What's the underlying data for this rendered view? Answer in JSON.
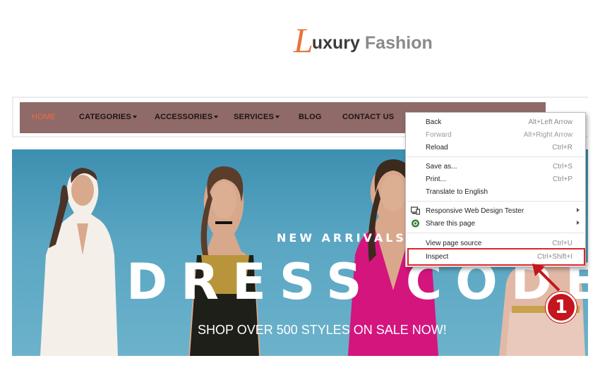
{
  "logo": {
    "initial": "L",
    "word1": "uxury",
    "word2": "Fashion"
  },
  "nav": {
    "items": [
      {
        "label": "HOME",
        "active": true,
        "has_dropdown": false
      },
      {
        "label": "CATEGORIES",
        "active": false,
        "has_dropdown": true
      },
      {
        "label": "ACCESSORIES",
        "active": false,
        "has_dropdown": true
      },
      {
        "label": "SERVICES",
        "active": false,
        "has_dropdown": true
      },
      {
        "label": "BLOG",
        "active": false,
        "has_dropdown": false
      },
      {
        "label": "CONTACT US",
        "active": false,
        "has_dropdown": false
      }
    ]
  },
  "hero": {
    "subtitle": "NEW ARRIVALS",
    "title": "DRESS CODE",
    "tagline": "SHOP OVER 500 STYLES ON SALE NOW!"
  },
  "context_menu": {
    "items": [
      {
        "label": "Back",
        "shortcut": "Alt+Left Arrow",
        "disabled": false
      },
      {
        "label": "Forward",
        "shortcut": "Alt+Right Arrow",
        "disabled": true
      },
      {
        "label": "Reload",
        "shortcut": "Ctrl+R",
        "disabled": false
      },
      {
        "label": "Save as...",
        "shortcut": "Ctrl+S",
        "disabled": false
      },
      {
        "label": "Print...",
        "shortcut": "Ctrl+P",
        "disabled": false
      },
      {
        "label": "Translate to English",
        "shortcut": "",
        "disabled": false
      },
      {
        "label": "Responsive Web Design Tester",
        "shortcut": "",
        "icon": "responsive-tester-icon",
        "submenu": true
      },
      {
        "label": "Share this page",
        "shortcut": "",
        "icon": "share-icon",
        "submenu": true
      },
      {
        "label": "View page source",
        "shortcut": "Ctrl+U",
        "disabled": false
      },
      {
        "label": "Inspect",
        "shortcut": "Ctrl+Shift+I",
        "disabled": false,
        "highlighted": true
      }
    ]
  },
  "annotation": {
    "step_number": "1"
  },
  "colors": {
    "nav_bg": "#8f6a68",
    "nav_active": "#f26a3a",
    "logo_accent": "#e8743b",
    "hero_bg": "#5aa6c3",
    "highlight": "#d9262c"
  }
}
